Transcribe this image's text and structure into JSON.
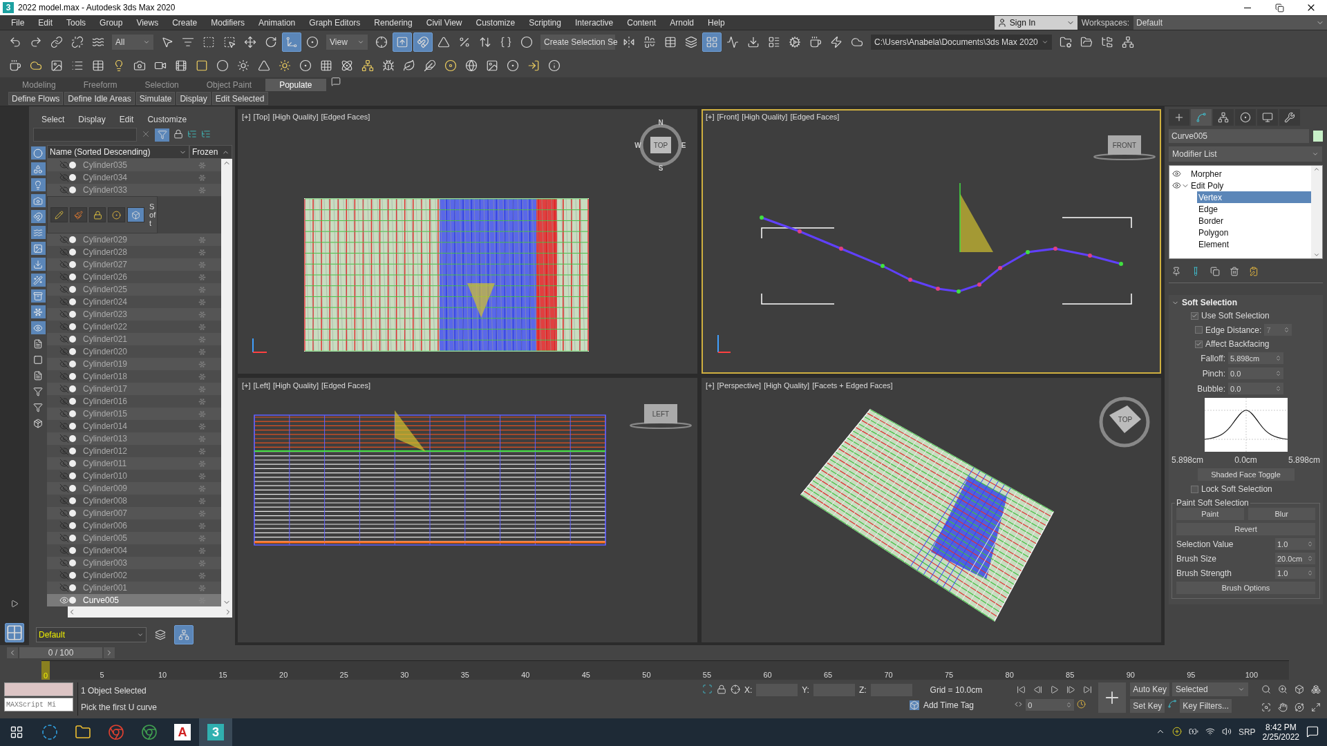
{
  "window": {
    "app_glyph": "3",
    "title": "2022 model.max - Autodesk 3ds Max 2020"
  },
  "menu": [
    "File",
    "Edit",
    "Tools",
    "Group",
    "Views",
    "Create",
    "Modifiers",
    "Animation",
    "Graph Editors",
    "Rendering",
    "Civil View",
    "Customize",
    "Scripting",
    "Interactive",
    "Content",
    "Arnold",
    "Help"
  ],
  "account": {
    "sign_in": "Sign In",
    "workspaces_label": "Workspaces:",
    "workspace": "Default"
  },
  "main_toolbar": [
    {
      "kind": "button",
      "selected": false
    },
    {
      "kind": "button",
      "selected": false
    },
    {
      "kind": "button",
      "selected": false
    },
    {
      "kind": "button",
      "selected": false
    },
    {
      "kind": "button",
      "selected": false
    },
    {
      "kind": "dropdown",
      "value": "All"
    },
    {
      "kind": "button",
      "selected": false
    },
    {
      "kind": "button",
      "selected": false
    },
    {
      "kind": "button",
      "selected": false
    },
    {
      "kind": "button",
      "selected": false
    },
    {
      "kind": "button",
      "selected": false
    },
    {
      "kind": "button",
      "selected": false
    },
    {
      "kind": "button",
      "selected": true
    },
    {
      "kind": "button",
      "selected": false
    },
    {
      "kind": "dropdown",
      "value": "View"
    },
    {
      "kind": "button",
      "selected": false
    },
    {
      "kind": "button",
      "selected": true
    },
    {
      "kind": "button",
      "selected": true
    },
    {
      "kind": "button",
      "selected": false
    },
    {
      "kind": "button",
      "selected": false
    },
    {
      "kind": "button",
      "selected": false
    },
    {
      "kind": "button",
      "selected": false
    },
    {
      "kind": "button",
      "selected": false
    },
    {
      "kind": "dropdown",
      "value": "Create Selection Se"
    },
    {
      "kind": "button",
      "selected": false
    },
    {
      "kind": "button",
      "selected": false
    },
    {
      "kind": "button",
      "selected": false
    },
    {
      "kind": "button",
      "selected": false
    },
    {
      "kind": "button",
      "selected": true
    },
    {
      "kind": "button",
      "selected": false
    },
    {
      "kind": "button",
      "selected": false
    },
    {
      "kind": "button",
      "selected": false
    },
    {
      "kind": "button",
      "selected": false
    },
    {
      "kind": "button",
      "selected": false
    },
    {
      "kind": "button",
      "selected": false
    },
    {
      "kind": "button",
      "selected": false
    },
    {
      "kind": "path",
      "value": "C:\\Users\\Anabela\\Documents\\3ds Max 2020"
    },
    {
      "kind": "button",
      "selected": false
    },
    {
      "kind": "button",
      "selected": false
    },
    {
      "kind": "button",
      "selected": false
    },
    {
      "kind": "button",
      "selected": false
    }
  ],
  "ribbon": {
    "tabs": [
      {
        "label": "Modeling",
        "selected": false
      },
      {
        "label": "Freeform",
        "selected": false
      },
      {
        "label": "Selection",
        "selected": false
      },
      {
        "label": "Object Paint",
        "selected": false
      },
      {
        "label": "Populate",
        "selected": true
      }
    ],
    "buttons": [
      "Define Flows",
      "Define Idle Areas",
      "Simulate",
      "Display",
      "Edit Selected"
    ]
  },
  "scene_explorer": {
    "menu": [
      "Select",
      "Display",
      "Edit",
      "Customize"
    ],
    "columns": [
      "Name (Sorted Descending)",
      "Frozen"
    ],
    "rows_top": [
      {
        "name": "Cylinder035",
        "visible": false,
        "selected": false
      },
      {
        "name": "Cylinder034",
        "visible": false,
        "selected": false
      },
      {
        "name": "Cylinder033",
        "visible": false,
        "selected": false
      }
    ],
    "palette_label": "Soft",
    "rows_bottom": [
      {
        "name": "Cylinder029",
        "visible": false,
        "selected": false
      },
      {
        "name": "Cylinder028",
        "visible": false,
        "selected": false
      },
      {
        "name": "Cylinder027",
        "visible": false,
        "selected": false
      },
      {
        "name": "Cylinder026",
        "visible": false,
        "selected": false
      },
      {
        "name": "Cylinder025",
        "visible": false,
        "selected": false
      },
      {
        "name": "Cylinder024",
        "visible": false,
        "selected": false
      },
      {
        "name": "Cylinder023",
        "visible": false,
        "selected": false
      },
      {
        "name": "Cylinder022",
        "visible": false,
        "selected": false
      },
      {
        "name": "Cylinder021",
        "visible": false,
        "selected": false
      },
      {
        "name": "Cylinder020",
        "visible": false,
        "selected": false
      },
      {
        "name": "Cylinder019",
        "visible": false,
        "selected": false
      },
      {
        "name": "Cylinder018",
        "visible": false,
        "selected": false
      },
      {
        "name": "Cylinder017",
        "visible": false,
        "selected": false
      },
      {
        "name": "Cylinder016",
        "visible": false,
        "selected": false
      },
      {
        "name": "Cylinder015",
        "visible": false,
        "selected": false
      },
      {
        "name": "Cylinder014",
        "visible": false,
        "selected": false
      },
      {
        "name": "Cylinder013",
        "visible": false,
        "selected": false
      },
      {
        "name": "Cylinder012",
        "visible": false,
        "selected": false
      },
      {
        "name": "Cylinder011",
        "visible": false,
        "selected": false
      },
      {
        "name": "Cylinder010",
        "visible": false,
        "selected": false
      },
      {
        "name": "Cylinder009",
        "visible": false,
        "selected": false
      },
      {
        "name": "Cylinder008",
        "visible": false,
        "selected": false
      },
      {
        "name": "Cylinder007",
        "visible": false,
        "selected": false
      },
      {
        "name": "Cylinder006",
        "visible": false,
        "selected": false
      },
      {
        "name": "Cylinder005",
        "visible": false,
        "selected": false
      },
      {
        "name": "Cylinder004",
        "visible": false,
        "selected": false
      },
      {
        "name": "Cylinder003",
        "visible": false,
        "selected": false
      },
      {
        "name": "Cylinder002",
        "visible": false,
        "selected": false
      },
      {
        "name": "Cylinder001",
        "visible": false,
        "selected": false
      },
      {
        "name": "Curve005",
        "visible": true,
        "selected": true
      }
    ],
    "layer": "Default"
  },
  "viewports": [
    {
      "kind": "top",
      "labels": [
        "[+]",
        "[Top]",
        "[High Quality]",
        "[Edged Faces]"
      ],
      "viewcube": "TOP",
      "compass": [
        "N",
        "E",
        "S",
        "W"
      ],
      "active": false
    },
    {
      "kind": "front",
      "labels": [
        "[+]",
        "[Front]",
        "[High Quality]",
        "[Edged Faces]"
      ],
      "viewcube": "FRONT",
      "active": true
    },
    {
      "kind": "left",
      "labels": [
        "[+]",
        "[Left]",
        "[High Quality]",
        "[Edged Faces]"
      ],
      "viewcube": "LEFT",
      "active": false
    },
    {
      "kind": "perspective",
      "labels": [
        "[+]",
        "[Perspective]",
        "[High Quality]",
        "[Facets + Edged Faces]"
      ],
      "viewcube": "TOP",
      "active": false
    }
  ],
  "command_panel": {
    "tabs": [
      {
        "selected": false
      },
      {
        "selected": true
      },
      {
        "selected": false
      },
      {
        "selected": false
      },
      {
        "selected": false
      },
      {
        "selected": false
      }
    ],
    "object_name": "Curve005",
    "modifier_list": "Modifier List",
    "stack": [
      {
        "name": "Morpher",
        "visible": true
      },
      {
        "name": "Edit Poly",
        "visible": true,
        "expanded": true,
        "children": [
          {
            "name": "Vertex",
            "selected": true
          },
          {
            "name": "Edge",
            "selected": false
          },
          {
            "name": "Border",
            "selected": false
          },
          {
            "name": "Polygon",
            "selected": false
          },
          {
            "name": "Element",
            "selected": false
          }
        ]
      }
    ],
    "soft_selection": {
      "title": "Soft Selection",
      "expanded": true,
      "options": [
        {
          "label": "Use Soft Selection",
          "checked": true
        },
        {
          "label": "Edge Distance:",
          "checked": false,
          "value": "7"
        },
        {
          "label": "Affect Backfacing",
          "checked": true
        }
      ],
      "params": [
        {
          "label": "Falloff:",
          "value": "5.898cm"
        },
        {
          "label": "Pinch:",
          "value": "0.0"
        },
        {
          "label": "Bubble:",
          "value": "0.0"
        }
      ],
      "curve_labels": [
        "5.898cm",
        "0.0cm",
        "5.898cm"
      ],
      "shaded_button": "Shaded Face Toggle",
      "lock": {
        "label": "Lock Soft Selection",
        "checked": false
      },
      "paint": {
        "title": "Paint Soft Selection",
        "buttons": [
          "Paint",
          "Blur"
        ],
        "revert": "Revert",
        "params": [
          {
            "label": "Selection Value",
            "value": "1.0"
          },
          {
            "label": "Brush Size",
            "value": "20.0cm"
          },
          {
            "label": "Brush Strength",
            "value": "1.0"
          }
        ],
        "options_button": "Brush Options"
      }
    }
  },
  "timeline": {
    "slider": "0 / 100",
    "current": "0",
    "labels": [
      "5",
      "10",
      "15",
      "20",
      "25",
      "30",
      "35",
      "40",
      "45",
      "50",
      "55",
      "60",
      "65",
      "70",
      "75",
      "80",
      "85",
      "90",
      "95",
      "100"
    ]
  },
  "status": {
    "script_field": "MAXScript Mi",
    "selection": "1 Object Selected",
    "prompt": "Pick the first U curve",
    "coords": [
      "X:",
      "Y:",
      "Z:"
    ],
    "grid": "Grid = 10.0cm",
    "time_tag": "Add Time Tag",
    "frame": "0",
    "auto_key": "Auto Key",
    "set_key": "Set Key",
    "key_mode": "Selected",
    "key_filters": "Key Filters..."
  },
  "taskbar": {
    "apps": [
      {
        "kind": "edge"
      },
      {
        "kind": "folder"
      },
      {
        "kind": "chrome"
      },
      {
        "kind": "chrome-profile"
      },
      {
        "kind": "autocad",
        "glyph": "A"
      },
      {
        "kind": "max",
        "glyph": "3",
        "selected": true
      }
    ],
    "language": "SRP",
    "time": "8:42 PM",
    "date": "2/25/2022"
  }
}
